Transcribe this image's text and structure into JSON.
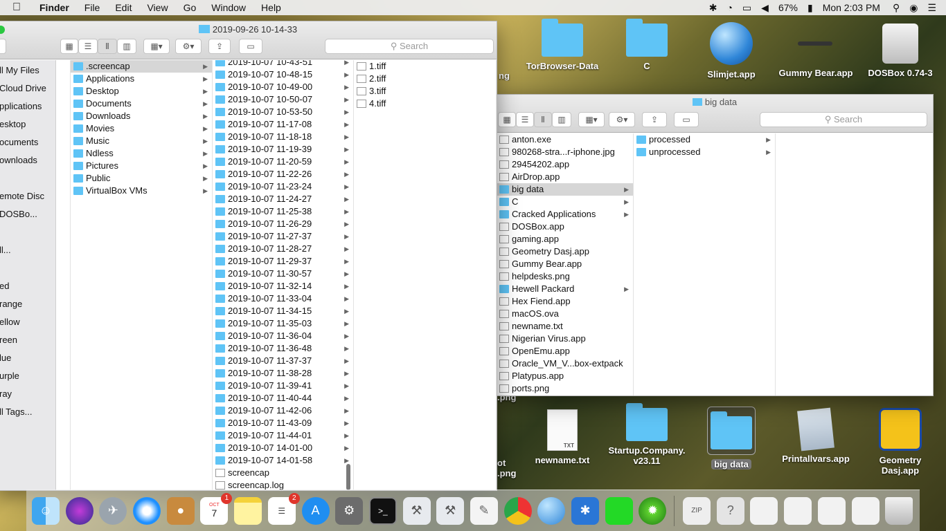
{
  "menubar": {
    "app": "Finder",
    "items": [
      "File",
      "Edit",
      "View",
      "Go",
      "Window",
      "Help"
    ],
    "battery": "67%",
    "clock": "Mon 2:03 PM"
  },
  "desktop": {
    "top": [
      {
        "label": "TorBrowser-Data",
        "kind": "folder"
      },
      {
        "label": "C",
        "kind": "folder"
      },
      {
        "label": "Slimjet.app",
        "kind": "globe"
      },
      {
        "label": "Gummy Bear.app",
        "kind": "tool"
      },
      {
        "label": "DOSBox 0.74-3",
        "kind": "drive"
      }
    ],
    "top_partial": "ng",
    "bottom": [
      {
        "label": "newname.txt",
        "kind": "txt"
      },
      {
        "label": "Startup.Company.\nv23.11",
        "kind": "folder"
      },
      {
        "label": "big data",
        "kind": "folder"
      },
      {
        "label": "Printallvars.app",
        "kind": "app"
      },
      {
        "label": "Geometry\nDasj.app",
        "kind": "gd"
      }
    ],
    "bottom_partial": "ot\n.png",
    "mid_partial": ".png",
    "txt_tag": "TXT"
  },
  "main": {
    "title": "2019-09-26 10-14-33",
    "search_placeholder": "Search",
    "sidebar": [
      "ll My Files",
      "Cloud Drive",
      "pplications",
      "esktop",
      "ocuments",
      "ownloads",
      "",
      "emote Disc",
      "DOSBo...",
      "",
      "ll...",
      "",
      "ed",
      "range",
      "ellow",
      "reen",
      "lue",
      "urple",
      "ray",
      "ll Tags..."
    ],
    "col1": [
      ".screencap",
      "Applications",
      "Desktop",
      "Documents",
      "Downloads",
      "Movies",
      "Music",
      "Ndless",
      "Pictures",
      "Public",
      "VirtualBox VMs"
    ],
    "col2": [
      "2019-10-07 10-43-51",
      "2019-10-07 10-48-15",
      "2019-10-07 10-49-00",
      "2019-10-07 10-50-07",
      "2019-10-07 10-53-50",
      "2019-10-07 11-17-08",
      "2019-10-07 11-18-18",
      "2019-10-07 11-19-39",
      "2019-10-07 11-20-59",
      "2019-10-07 11-22-26",
      "2019-10-07 11-23-24",
      "2019-10-07 11-24-27",
      "2019-10-07 11-25-38",
      "2019-10-07 11-26-29",
      "2019-10-07 11-27-37",
      "2019-10-07 11-28-27",
      "2019-10-07 11-29-37",
      "2019-10-07 11-30-57",
      "2019-10-07 11-32-14",
      "2019-10-07 11-33-04",
      "2019-10-07 11-34-15",
      "2019-10-07 11-35-03",
      "2019-10-07 11-36-04",
      "2019-10-07 11-36-48",
      "2019-10-07 11-37-37",
      "2019-10-07 11-38-28",
      "2019-10-07 11-39-41",
      "2019-10-07 11-40-44",
      "2019-10-07 11-42-06",
      "2019-10-07 11-43-09",
      "2019-10-07 11-44-01",
      "2019-10-07 14-01-00",
      "2019-10-07 14-01-58"
    ],
    "col2_files": [
      "screencap",
      "screencap.log"
    ],
    "col3": [
      "1.tiff",
      "2.tiff",
      "3.tiff",
      "4.tiff"
    ]
  },
  "second": {
    "title": "big data",
    "search_placeholder": "Search",
    "col1": [
      {
        "n": "anton.exe",
        "f": false
      },
      {
        "n": "980268-stra...r-iphone.jpg",
        "f": false
      },
      {
        "n": "29454202.app",
        "f": false
      },
      {
        "n": "AirDrop.app",
        "f": false
      },
      {
        "n": "big data",
        "f": true,
        "sel": true
      },
      {
        "n": "C",
        "f": true
      },
      {
        "n": "Cracked Applications",
        "f": true
      },
      {
        "n": "DOSBox.app",
        "f": false
      },
      {
        "n": "gaming.app",
        "f": false
      },
      {
        "n": "Geometry Dasj.app",
        "f": false
      },
      {
        "n": "Gummy Bear.app",
        "f": false
      },
      {
        "n": "helpdesks.png",
        "f": false
      },
      {
        "n": "Hewell Packard",
        "f": true
      },
      {
        "n": "Hex Fiend.app",
        "f": false
      },
      {
        "n": "macOS.ova",
        "f": false
      },
      {
        "n": "newname.txt",
        "f": false
      },
      {
        "n": "Nigerian Virus.app",
        "f": false
      },
      {
        "n": "OpenEmu.app",
        "f": false
      },
      {
        "n": "Oracle_VM_V...box-extpack",
        "f": false
      },
      {
        "n": "Platypus.app",
        "f": false
      },
      {
        "n": "ports.png",
        "f": false
      }
    ],
    "col2": [
      "processed",
      "unprocessed"
    ]
  },
  "dock": {
    "calendar_month": "OCT",
    "calendar_day": "7",
    "calendar_badge": "1",
    "reminders_badge": "2"
  }
}
